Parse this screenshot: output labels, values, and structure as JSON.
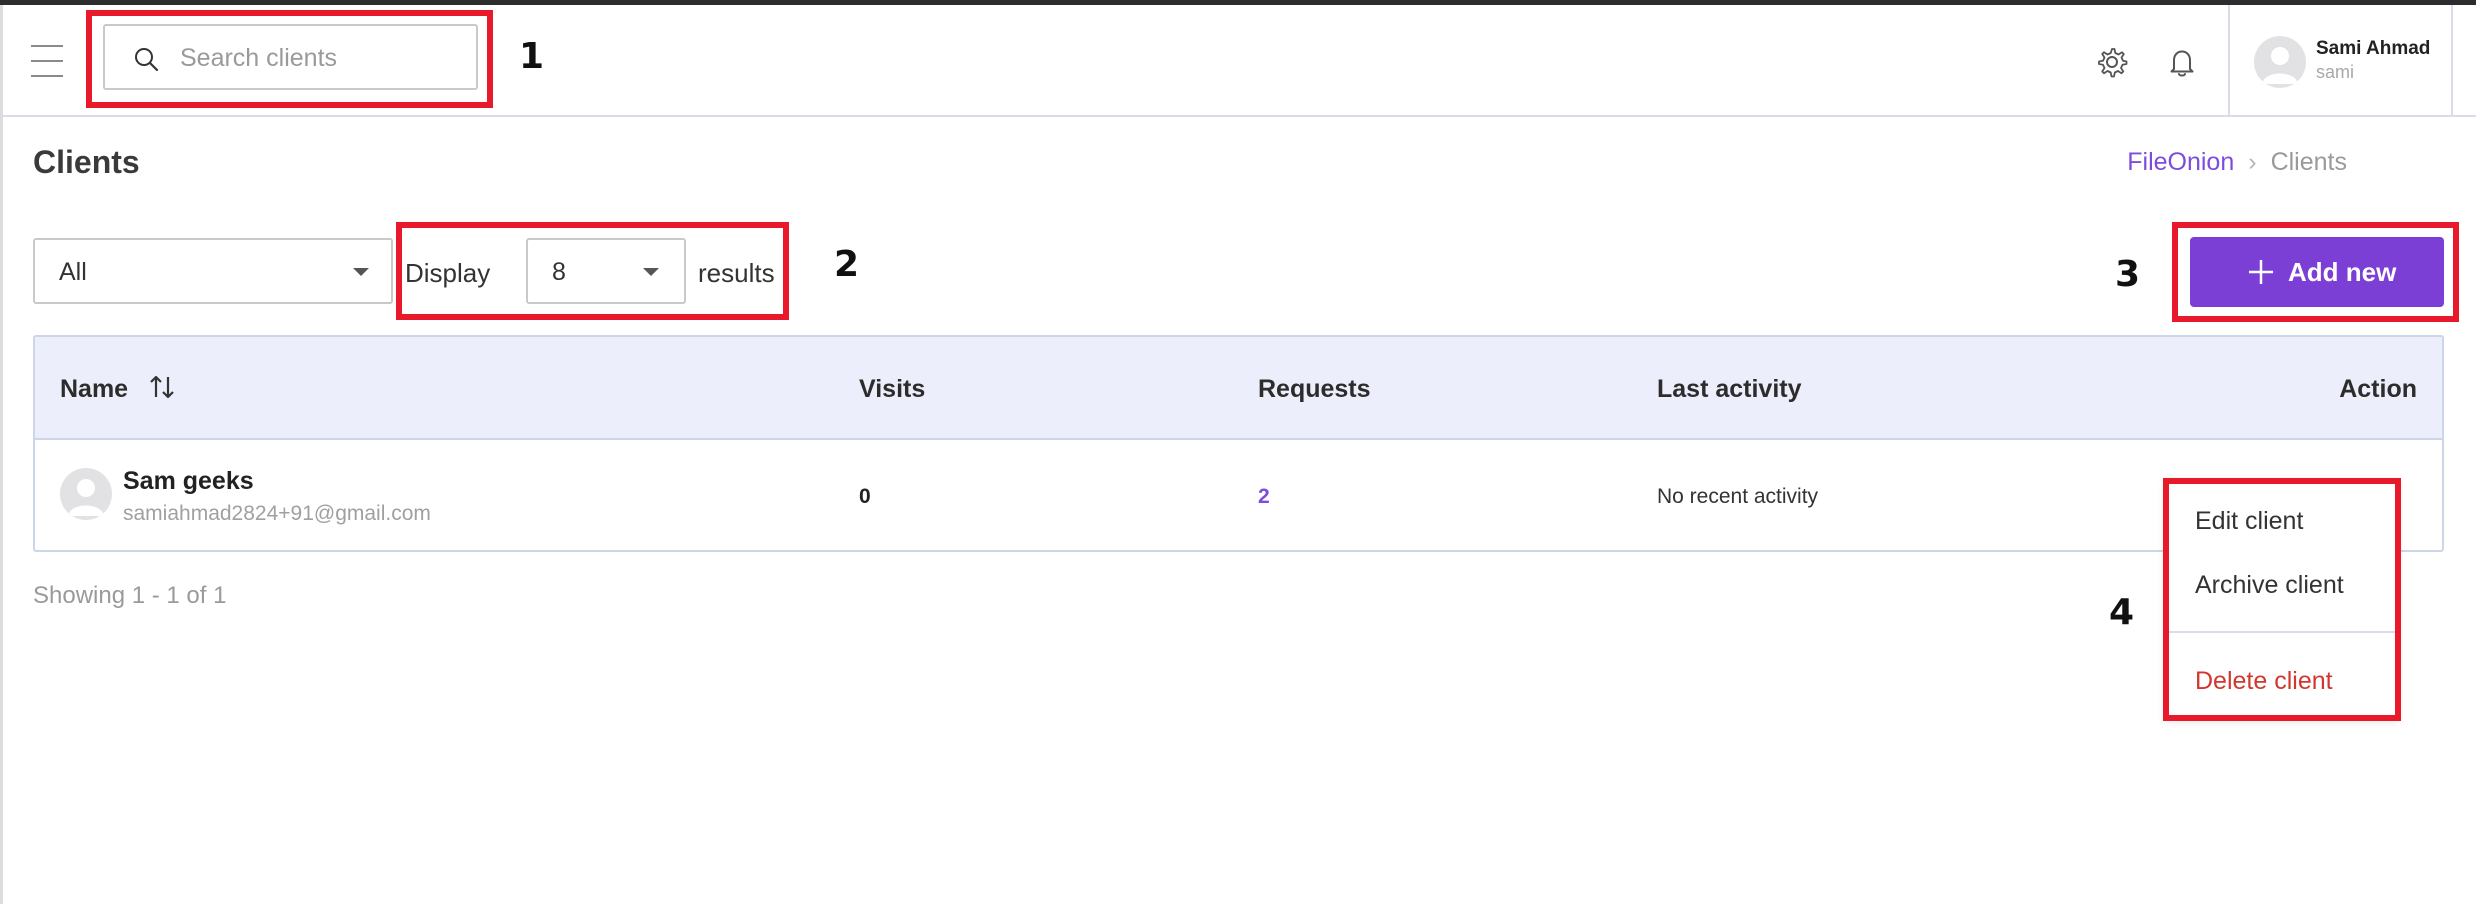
{
  "header": {
    "search_placeholder": "Search clients",
    "user": {
      "name": "Sami Ahmad",
      "handle": "sami"
    },
    "icons": [
      "menu-icon",
      "search-icon",
      "gear-icon",
      "bell-icon",
      "avatar"
    ]
  },
  "page": {
    "title": "Clients",
    "breadcrumb": {
      "root": "FileOnion",
      "separator": "›",
      "current": "Clients"
    }
  },
  "filters": {
    "status_value": "All",
    "display_label": "Display",
    "display_value": "8",
    "results_label": "results"
  },
  "add_button": {
    "label": "Add new"
  },
  "table": {
    "columns": {
      "name": "Name",
      "visits": "Visits",
      "requests": "Requests",
      "last_activity": "Last activity",
      "action": "Action"
    },
    "rows": [
      {
        "name": "Sam geeks",
        "email": "samiahmad2824+91@gmail.com",
        "visits": "0",
        "requests": "2",
        "last_activity": "No recent activity"
      }
    ]
  },
  "pagination": {
    "text": "Showing 1 - 1 of 1"
  },
  "action_menu": {
    "items": {
      "edit": "Edit client",
      "archive": "Archive client",
      "delete": "Delete client"
    }
  },
  "annotations": [
    "1",
    "2",
    "3",
    "4"
  ],
  "colors": {
    "accent": "#7c3fd6",
    "danger": "#d0382f",
    "annotation": "#e8192b",
    "table_header_bg": "#edeefb"
  }
}
